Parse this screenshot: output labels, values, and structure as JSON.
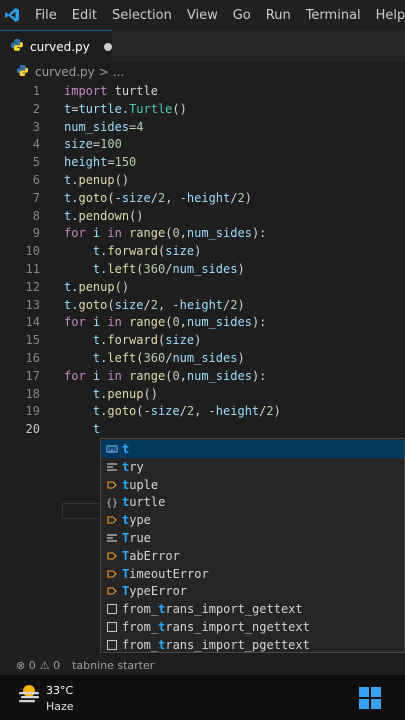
{
  "menubar": {
    "items": [
      "File",
      "Edit",
      "Selection",
      "View",
      "Go",
      "Run",
      "Terminal",
      "Help"
    ]
  },
  "tab": {
    "label": "curved.py"
  },
  "breadcrumb": {
    "file": "curved.py",
    "separator": ">",
    "more": "..."
  },
  "editor": {
    "lines": [
      {
        "n": "1",
        "tokens": [
          [
            "kw",
            "import"
          ],
          [
            "plain",
            " "
          ],
          [
            "plain",
            "turtle"
          ]
        ]
      },
      {
        "n": "2",
        "tokens": [
          [
            "var",
            "t"
          ],
          [
            "plain",
            "="
          ],
          [
            "var",
            "turtle"
          ],
          [
            "plain",
            "."
          ],
          [
            "cls",
            "Turtle"
          ],
          [
            "plain",
            "()"
          ]
        ]
      },
      {
        "n": "3",
        "tokens": [
          [
            "var",
            "num_sides"
          ],
          [
            "plain",
            "="
          ],
          [
            "num",
            "4"
          ]
        ]
      },
      {
        "n": "4",
        "tokens": [
          [
            "var",
            "size"
          ],
          [
            "plain",
            "="
          ],
          [
            "num",
            "100"
          ]
        ]
      },
      {
        "n": "5",
        "tokens": [
          [
            "var",
            "height"
          ],
          [
            "plain",
            "="
          ],
          [
            "num",
            "150"
          ]
        ]
      },
      {
        "n": "6",
        "tokens": [
          [
            "var",
            "t"
          ],
          [
            "plain",
            "."
          ],
          [
            "fn",
            "penup"
          ],
          [
            "plain",
            "()"
          ]
        ]
      },
      {
        "n": "7",
        "tokens": [
          [
            "var",
            "t"
          ],
          [
            "plain",
            "."
          ],
          [
            "fn",
            "goto"
          ],
          [
            "plain",
            "(-"
          ],
          [
            "var",
            "size"
          ],
          [
            "plain",
            "/"
          ],
          [
            "num",
            "2"
          ],
          [
            "plain",
            ", -"
          ],
          [
            "var",
            "height"
          ],
          [
            "plain",
            "/"
          ],
          [
            "num",
            "2"
          ],
          [
            "plain",
            ")"
          ]
        ]
      },
      {
        "n": "8",
        "tokens": [
          [
            "var",
            "t"
          ],
          [
            "plain",
            "."
          ],
          [
            "fn",
            "pendown"
          ],
          [
            "plain",
            "()"
          ]
        ]
      },
      {
        "n": "9",
        "tokens": [
          [
            "kw",
            "for"
          ],
          [
            "plain",
            " "
          ],
          [
            "var",
            "i"
          ],
          [
            "plain",
            " "
          ],
          [
            "kw",
            "in"
          ],
          [
            "plain",
            " "
          ],
          [
            "fn",
            "range"
          ],
          [
            "plain",
            "("
          ],
          [
            "num",
            "0"
          ],
          [
            "plain",
            ","
          ],
          [
            "var",
            "num_sides"
          ],
          [
            "plain",
            "):"
          ]
        ]
      },
      {
        "n": "10",
        "tokens": [
          [
            "plain",
            "    "
          ],
          [
            "var",
            "t"
          ],
          [
            "plain",
            "."
          ],
          [
            "fn",
            "forward"
          ],
          [
            "plain",
            "("
          ],
          [
            "var",
            "size"
          ],
          [
            "plain",
            ")"
          ]
        ]
      },
      {
        "n": "11",
        "tokens": [
          [
            "plain",
            "    "
          ],
          [
            "var",
            "t"
          ],
          [
            "plain",
            "."
          ],
          [
            "fn",
            "left"
          ],
          [
            "plain",
            "("
          ],
          [
            "num",
            "360"
          ],
          [
            "plain",
            "/"
          ],
          [
            "var",
            "num_sides"
          ],
          [
            "plain",
            ")"
          ]
        ]
      },
      {
        "n": "12",
        "tokens": [
          [
            "var",
            "t"
          ],
          [
            "plain",
            "."
          ],
          [
            "fn",
            "penup"
          ],
          [
            "plain",
            "()"
          ]
        ]
      },
      {
        "n": "13",
        "tokens": [
          [
            "var",
            "t"
          ],
          [
            "plain",
            "."
          ],
          [
            "fn",
            "goto"
          ],
          [
            "plain",
            "("
          ],
          [
            "var",
            "size"
          ],
          [
            "plain",
            "/"
          ],
          [
            "num",
            "2"
          ],
          [
            "plain",
            ", -"
          ],
          [
            "var",
            "height"
          ],
          [
            "plain",
            "/"
          ],
          [
            "num",
            "2"
          ],
          [
            "plain",
            ")"
          ]
        ]
      },
      {
        "n": "14",
        "tokens": [
          [
            "kw",
            "for"
          ],
          [
            "plain",
            " "
          ],
          [
            "var",
            "i"
          ],
          [
            "plain",
            " "
          ],
          [
            "kw",
            "in"
          ],
          [
            "plain",
            " "
          ],
          [
            "fn",
            "range"
          ],
          [
            "plain",
            "("
          ],
          [
            "num",
            "0"
          ],
          [
            "plain",
            ","
          ],
          [
            "var",
            "num_sides"
          ],
          [
            "plain",
            "):"
          ]
        ]
      },
      {
        "n": "15",
        "tokens": [
          [
            "plain",
            "    "
          ],
          [
            "var",
            "t"
          ],
          [
            "plain",
            "."
          ],
          [
            "fn",
            "forward"
          ],
          [
            "plain",
            "("
          ],
          [
            "var",
            "size"
          ],
          [
            "plain",
            ")"
          ]
        ]
      },
      {
        "n": "16",
        "tokens": [
          [
            "plain",
            "    "
          ],
          [
            "var",
            "t"
          ],
          [
            "plain",
            "."
          ],
          [
            "fn",
            "left"
          ],
          [
            "plain",
            "("
          ],
          [
            "num",
            "360"
          ],
          [
            "plain",
            "/"
          ],
          [
            "var",
            "num_sides"
          ],
          [
            "plain",
            ")"
          ]
        ]
      },
      {
        "n": "17",
        "tokens": [
          [
            "kw",
            "for"
          ],
          [
            "plain",
            " "
          ],
          [
            "var",
            "i"
          ],
          [
            "plain",
            " "
          ],
          [
            "kw",
            "in"
          ],
          [
            "plain",
            " "
          ],
          [
            "fn",
            "range"
          ],
          [
            "plain",
            "("
          ],
          [
            "num",
            "0"
          ],
          [
            "plain",
            ","
          ],
          [
            "var",
            "num_sides"
          ],
          [
            "plain",
            "):"
          ]
        ]
      },
      {
        "n": "18",
        "tokens": [
          [
            "plain",
            "    "
          ],
          [
            "var",
            "t"
          ],
          [
            "plain",
            "."
          ],
          [
            "fn",
            "penup"
          ],
          [
            "plain",
            "()"
          ]
        ]
      },
      {
        "n": "19",
        "tokens": [
          [
            "plain",
            "    "
          ],
          [
            "var",
            "t"
          ],
          [
            "plain",
            "."
          ],
          [
            "fn",
            "goto"
          ],
          [
            "plain",
            "(-"
          ],
          [
            "var",
            "size"
          ],
          [
            "plain",
            "/"
          ],
          [
            "num",
            "2"
          ],
          [
            "plain",
            ", -"
          ],
          [
            "var",
            "height"
          ],
          [
            "plain",
            "/"
          ],
          [
            "num",
            "2"
          ],
          [
            "plain",
            ")"
          ]
        ]
      },
      {
        "n": "20",
        "tokens": [
          [
            "plain",
            "    "
          ],
          [
            "var",
            "t"
          ]
        ]
      }
    ],
    "current_line": 20
  },
  "suggestions": {
    "typed": "t",
    "items": [
      {
        "kind": "variable-icon",
        "label": "t"
      },
      {
        "kind": "keyword-icon",
        "label": "try"
      },
      {
        "kind": "class-icon",
        "label": "tuple"
      },
      {
        "kind": "module-icon",
        "label": "turtle"
      },
      {
        "kind": "class-icon",
        "label": "type"
      },
      {
        "kind": "keyword-icon",
        "label": "True"
      },
      {
        "kind": "class-icon",
        "label": "TabError"
      },
      {
        "kind": "class-icon",
        "label": "TimeoutError"
      },
      {
        "kind": "class-icon",
        "label": "TypeError"
      },
      {
        "kind": "snippet-icon",
        "label": "from_trans_import_gettext"
      },
      {
        "kind": "snippet-icon",
        "label": "from_trans_import_ngettext"
      },
      {
        "kind": "snippet-icon",
        "label": "from_trans_import_pgettext"
      }
    ]
  },
  "statusbar": {
    "errors": "⊗ 0",
    "warnings": "⚠ 0",
    "tabnine": "tabnine starter"
  },
  "taskbar": {
    "temperature": "33°C",
    "condition": "Haze"
  },
  "colors": {
    "keyword": "#c586c0",
    "function": "#dcdcaa",
    "variable": "#9cdcfe",
    "class": "#4ec9b0",
    "number": "#b5cea8",
    "accent": "#0e639c"
  }
}
